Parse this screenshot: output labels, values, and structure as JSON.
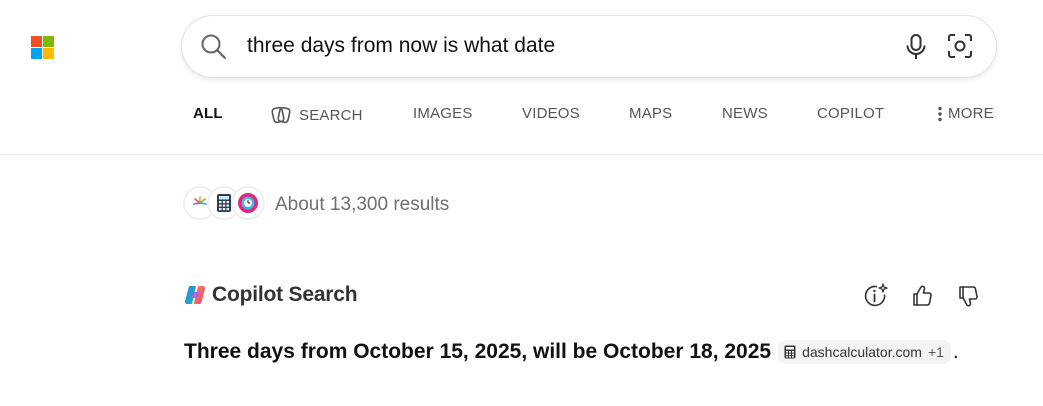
{
  "brand": {
    "colors": [
      "#f25022",
      "#7fba00",
      "#00a4ef",
      "#ffb900"
    ]
  },
  "search": {
    "query": "three days from now is what date",
    "icons": [
      "search-icon",
      "microphone-icon",
      "visual-search-icon"
    ]
  },
  "nav": {
    "tabs": [
      {
        "label": "ALL",
        "active": true
      },
      {
        "label": "SEARCH",
        "icon": "copilot-search-icon"
      },
      {
        "label": "IMAGES"
      },
      {
        "label": "VIDEOS"
      },
      {
        "label": "MAPS"
      },
      {
        "label": "NEWS"
      },
      {
        "label": "COPILOT"
      },
      {
        "label": "MORE",
        "icon": "more-vertical-icon"
      }
    ]
  },
  "results": {
    "count_text": "About 13,300 results",
    "source_favicons": [
      "sunburst-favicon",
      "calculator-favicon",
      "clock-favicon"
    ]
  },
  "copilot": {
    "title": "Copilot Search",
    "actions": [
      "info-sparkle-icon",
      "thumbs-up-icon",
      "thumbs-down-icon"
    ],
    "answer": "Three days from October 15, 2025, will be October 18, 2025",
    "citation": {
      "domain": "dashcalculator.com",
      "extra": "+1"
    },
    "trailing": "."
  }
}
